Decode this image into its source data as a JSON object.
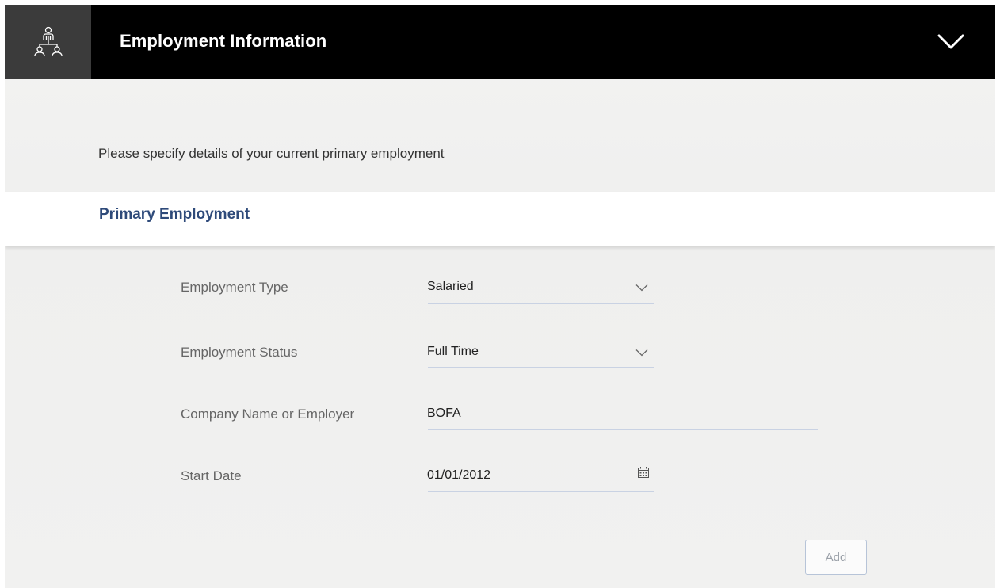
{
  "header": {
    "title": "Employment Information",
    "icon": "people-network-icon",
    "toggle_icon": "chevron-down-icon"
  },
  "intro_text": "Please specify details of your current primary employment",
  "section": {
    "title": "Primary Employment"
  },
  "fields": {
    "employment_type": {
      "label": "Employment Type",
      "value": "Salaried",
      "icon": "chevron-down-icon"
    },
    "employment_status": {
      "label": "Employment Status",
      "value": "Full Time",
      "icon": "chevron-down-icon"
    },
    "company_name": {
      "label": "Company Name or Employer",
      "value": "BOFA"
    },
    "start_date": {
      "label": "Start Date",
      "value": "01/01/2012",
      "icon": "calendar-icon"
    }
  },
  "actions": {
    "add_label": "Add"
  },
  "colors": {
    "header_bg": "#000000",
    "icon_box_bg": "#3b3b3b",
    "section_title": "#2e4a7a",
    "field_line": "#c9d2e3"
  }
}
